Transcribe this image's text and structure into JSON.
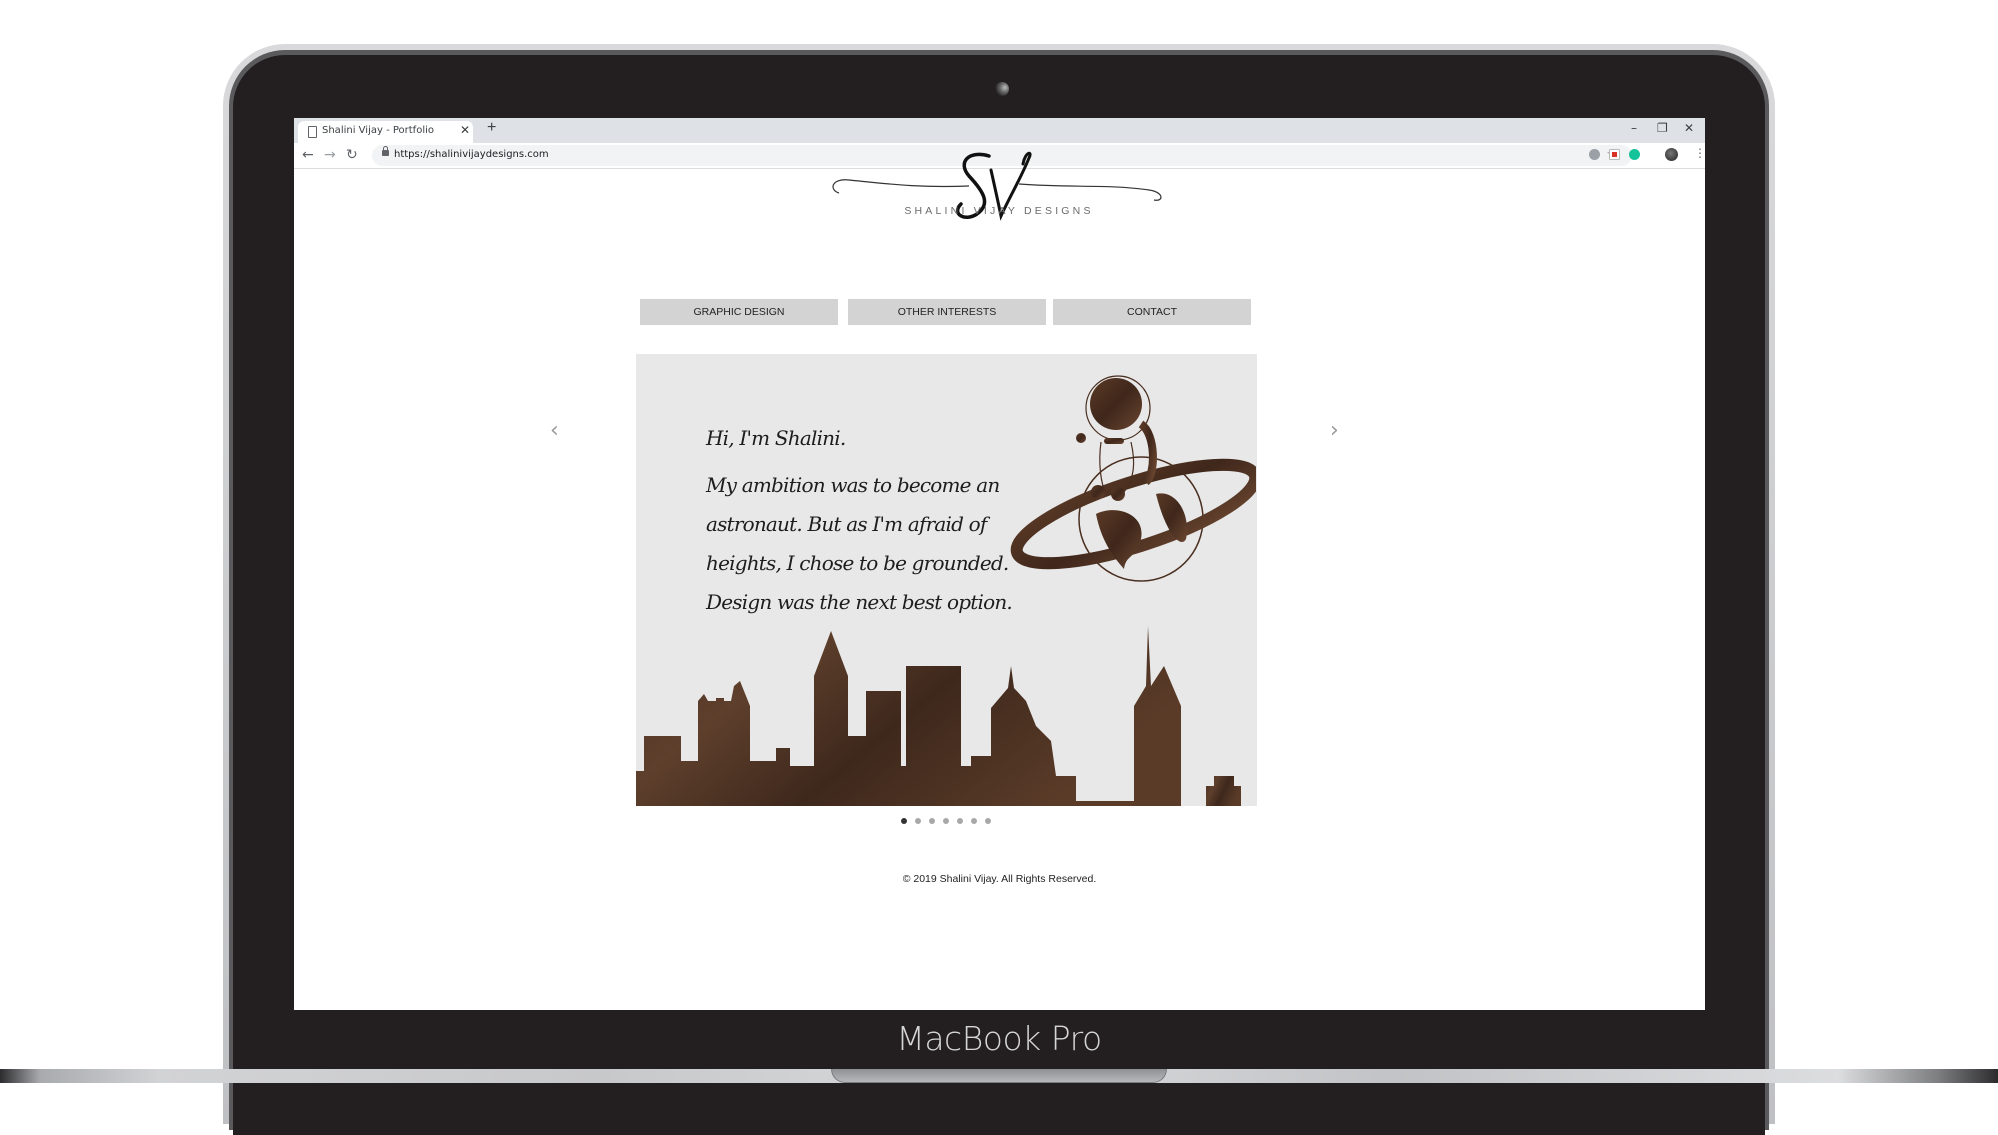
{
  "device": {
    "brand_label": "MacBook Pro"
  },
  "browser": {
    "tab_title": "Shalini Vijay - Portfolio",
    "url": "https://shalinivijaydesigns.com",
    "icons": [
      "document-icon",
      "close-tab-icon",
      "new-tab-icon",
      "minimize-icon",
      "restore-icon",
      "close-window-icon",
      "back-icon",
      "forward-icon",
      "reload-icon",
      "lock-icon",
      "bookmark-star-icon",
      "extension-icon",
      "pdf-extension-icon",
      "grammarly-icon",
      "profile-avatar",
      "menu-icon"
    ],
    "window_controls": {
      "minimize": "–",
      "restore": "❐",
      "close": "✕"
    }
  },
  "site": {
    "logo_monogram": "SV",
    "logo_subtitle": "SHALINI VIJAY DESIGNS",
    "nav": [
      {
        "label": "GRAPHIC DESIGN"
      },
      {
        "label": "OTHER INTERESTS"
      },
      {
        "label": "CONTACT"
      }
    ],
    "slider": {
      "current_slide": 1,
      "total_slides": 7,
      "prev_label": "‹",
      "next_label": "›",
      "slide_text": [
        "Hi, I'm Shalini.",
        "My ambition was to become an",
        "astronaut. But as I'm afraid of",
        "heights, I chose to be grounded.",
        "Design was the next best option."
      ],
      "accent_color": "#4a3326",
      "background_color": "#e8e8e8"
    },
    "footer": "© 2019 Shalini Vijay. All Rights Reserved."
  }
}
